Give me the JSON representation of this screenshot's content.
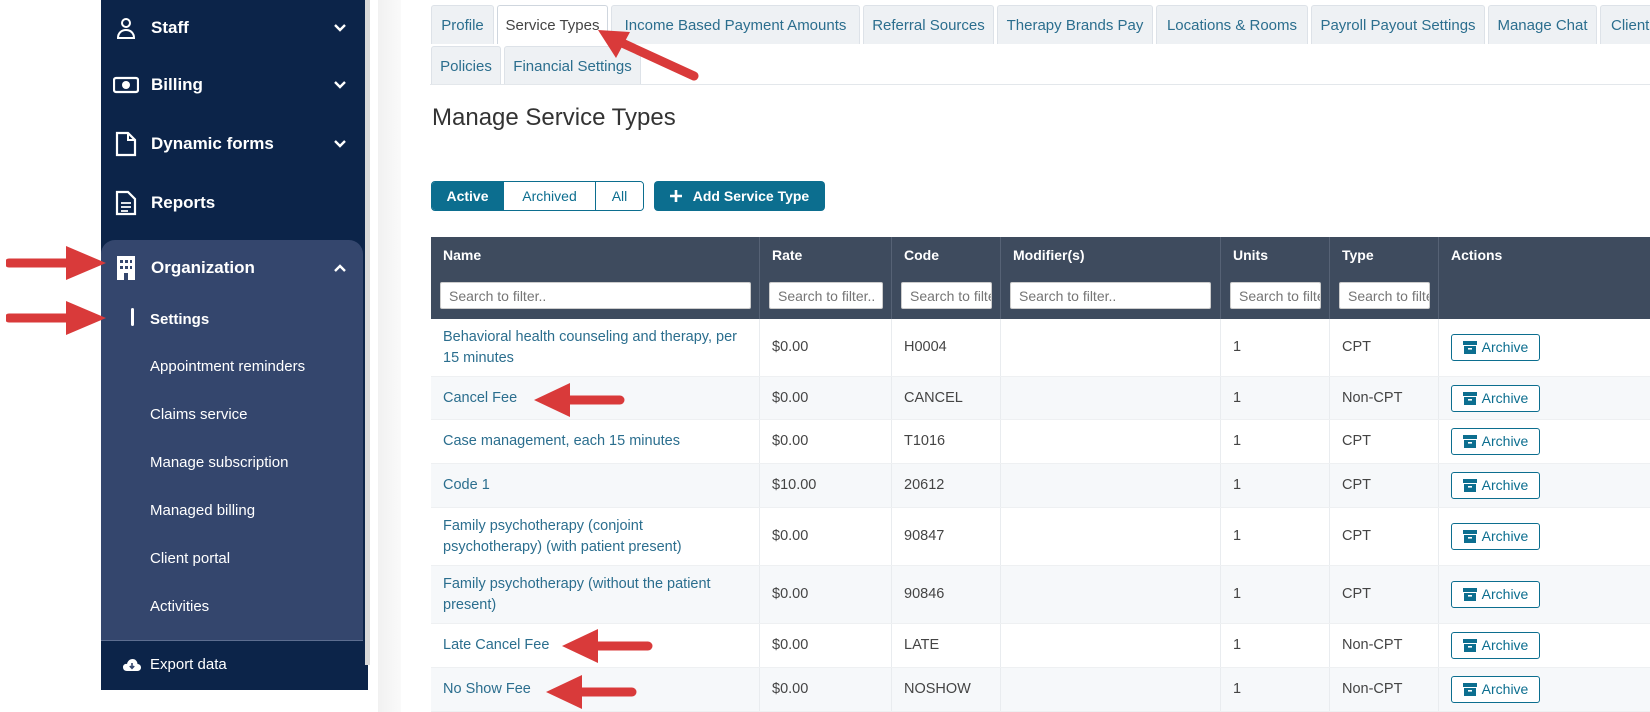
{
  "sidebar": {
    "items": [
      {
        "label": "Staff",
        "icon": "staff-icon"
      },
      {
        "label": "Billing",
        "icon": "billing-icon"
      },
      {
        "label": "Dynamic forms",
        "icon": "document-icon"
      },
      {
        "label": "Reports",
        "icon": "report-icon"
      },
      {
        "label": "Organization",
        "icon": "building-icon"
      }
    ],
    "org_subitems": [
      "Settings",
      "Appointment reminders",
      "Claims service",
      "Manage subscription",
      "Managed billing",
      "Client portal",
      "Activities"
    ],
    "export_label": "Export data"
  },
  "tabs": {
    "row1": [
      "Profile",
      "Service Types",
      "Income Based Payment Amounts",
      "Referral Sources",
      "Therapy Brands Pay",
      "Locations & Rooms",
      "Payroll Payout Settings",
      "Manage Chat",
      "Client"
    ],
    "row2": [
      "Policies",
      "Financial Settings"
    ],
    "active": "Service Types"
  },
  "page_title": "Manage Service Types",
  "filters": {
    "active": "Active",
    "archived": "Archived",
    "all": "All"
  },
  "add_button": "Add Service Type",
  "table": {
    "headers": [
      "Name",
      "Rate",
      "Code",
      "Modifier(s)",
      "Units",
      "Type",
      "Actions"
    ],
    "placeholders": [
      "Search to filter..",
      "Search to filter..",
      "Search to filter..",
      "Search to filter..",
      "Search to filter..",
      "Search to filter.."
    ],
    "archive_label": "Archive",
    "rows": [
      {
        "name": "Behavioral health counseling and therapy, per 15 minutes",
        "rate": "$0.00",
        "code": "H0004",
        "modifiers": "",
        "units": "1",
        "type": "CPT"
      },
      {
        "name": "Cancel Fee",
        "rate": "$0.00",
        "code": "CANCEL",
        "modifiers": "",
        "units": "1",
        "type": "Non-CPT"
      },
      {
        "name": "Case management, each 15 minutes",
        "rate": "$0.00",
        "code": "T1016",
        "modifiers": "",
        "units": "1",
        "type": "CPT"
      },
      {
        "name": "Code 1",
        "rate": "$10.00",
        "code": "20612",
        "modifiers": "",
        "units": "1",
        "type": "CPT"
      },
      {
        "name": "Family psychotherapy (conjoint psychotherapy) (with patient present)",
        "rate": "$0.00",
        "code": "90847",
        "modifiers": "",
        "units": "1",
        "type": "CPT"
      },
      {
        "name": "Family psychotherapy (without the patient present)",
        "rate": "$0.00",
        "code": "90846",
        "modifiers": "",
        "units": "1",
        "type": "CPT"
      },
      {
        "name": "Late Cancel Fee",
        "rate": "$0.00",
        "code": "LATE",
        "modifiers": "",
        "units": "1",
        "type": "Non-CPT"
      },
      {
        "name": "No Show Fee",
        "rate": "$0.00",
        "code": "NOSHOW",
        "modifiers": "",
        "units": "1",
        "type": "Non-CPT"
      }
    ]
  },
  "colors": {
    "sidebar": "#0c2449",
    "panel": "#34466d",
    "accent": "#0c6e8f",
    "arrow": "#d93a3a",
    "header": "#3e4b5e"
  }
}
